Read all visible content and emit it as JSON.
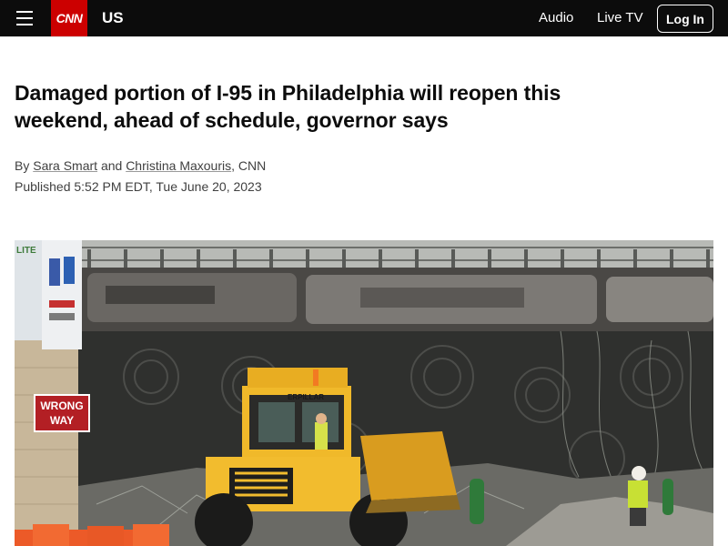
{
  "header": {
    "logo_text": "CNN",
    "section": "US",
    "nav": {
      "audio": "Audio",
      "live_tv": "Live TV"
    },
    "login_label": "Log In",
    "colors": {
      "bar": "#0c0c0c",
      "logo_bg": "#cc0000"
    }
  },
  "article": {
    "headline": "Damaged portion of I-95 in Philadelphia will reopen this weekend, ahead of schedule, governor says",
    "byline": {
      "prefix": "By",
      "author1": "Sara Smart",
      "conjunction": "and",
      "author2": "Christina Maxouris",
      "suffix": ", CNN"
    },
    "published": "Published 5:52 PM EDT, Tue June 20, 2023"
  },
  "photo": {
    "sign_line1": "WRONG",
    "sign_line2": "WAY",
    "loader_brand": "ERPILLAR",
    "billboard_text": "LITE"
  }
}
